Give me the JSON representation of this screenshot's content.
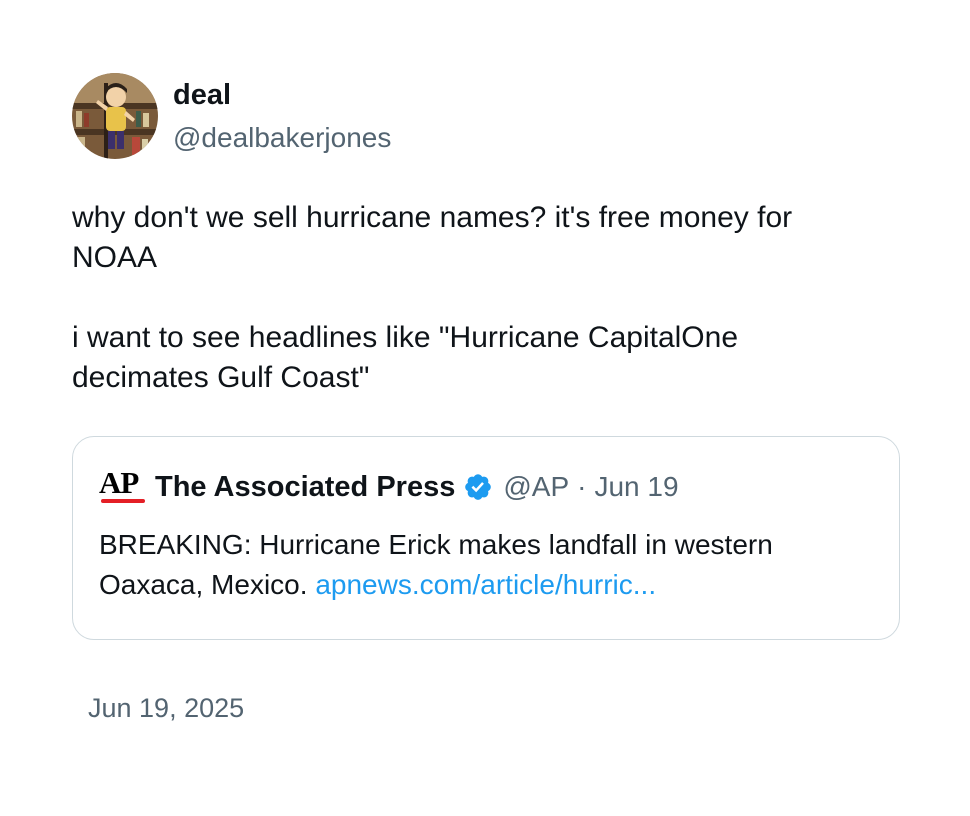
{
  "author": {
    "display_name": "deal",
    "handle": "@dealbakerjones",
    "avatar_icon": "cartoon-character-avatar"
  },
  "tweet": {
    "text": "why don't we sell hurricane names? it's free money for\nNOAA\n\ni want to see headlines like \"Hurricane CapitalOne\ndecimates Gulf Coast\"",
    "timestamp": "Jun 19, 2025"
  },
  "quote": {
    "logo_text": "AP",
    "display_name": "The Associated Press",
    "verified_icon": "verified-badge-icon",
    "handle": "@AP",
    "separator": "·",
    "date": "Jun 19",
    "body": "BREAKING: Hurricane Erick makes landfall in western Oaxaca, Mexico. ",
    "link": "apnews.com/article/hurric..."
  },
  "colors": {
    "text": "#0f1419",
    "secondary": "#536471",
    "link": "#1d9bf0",
    "verified": "#1d9bf0",
    "ap_red": "#e41f26",
    "border": "#cfd9de"
  }
}
